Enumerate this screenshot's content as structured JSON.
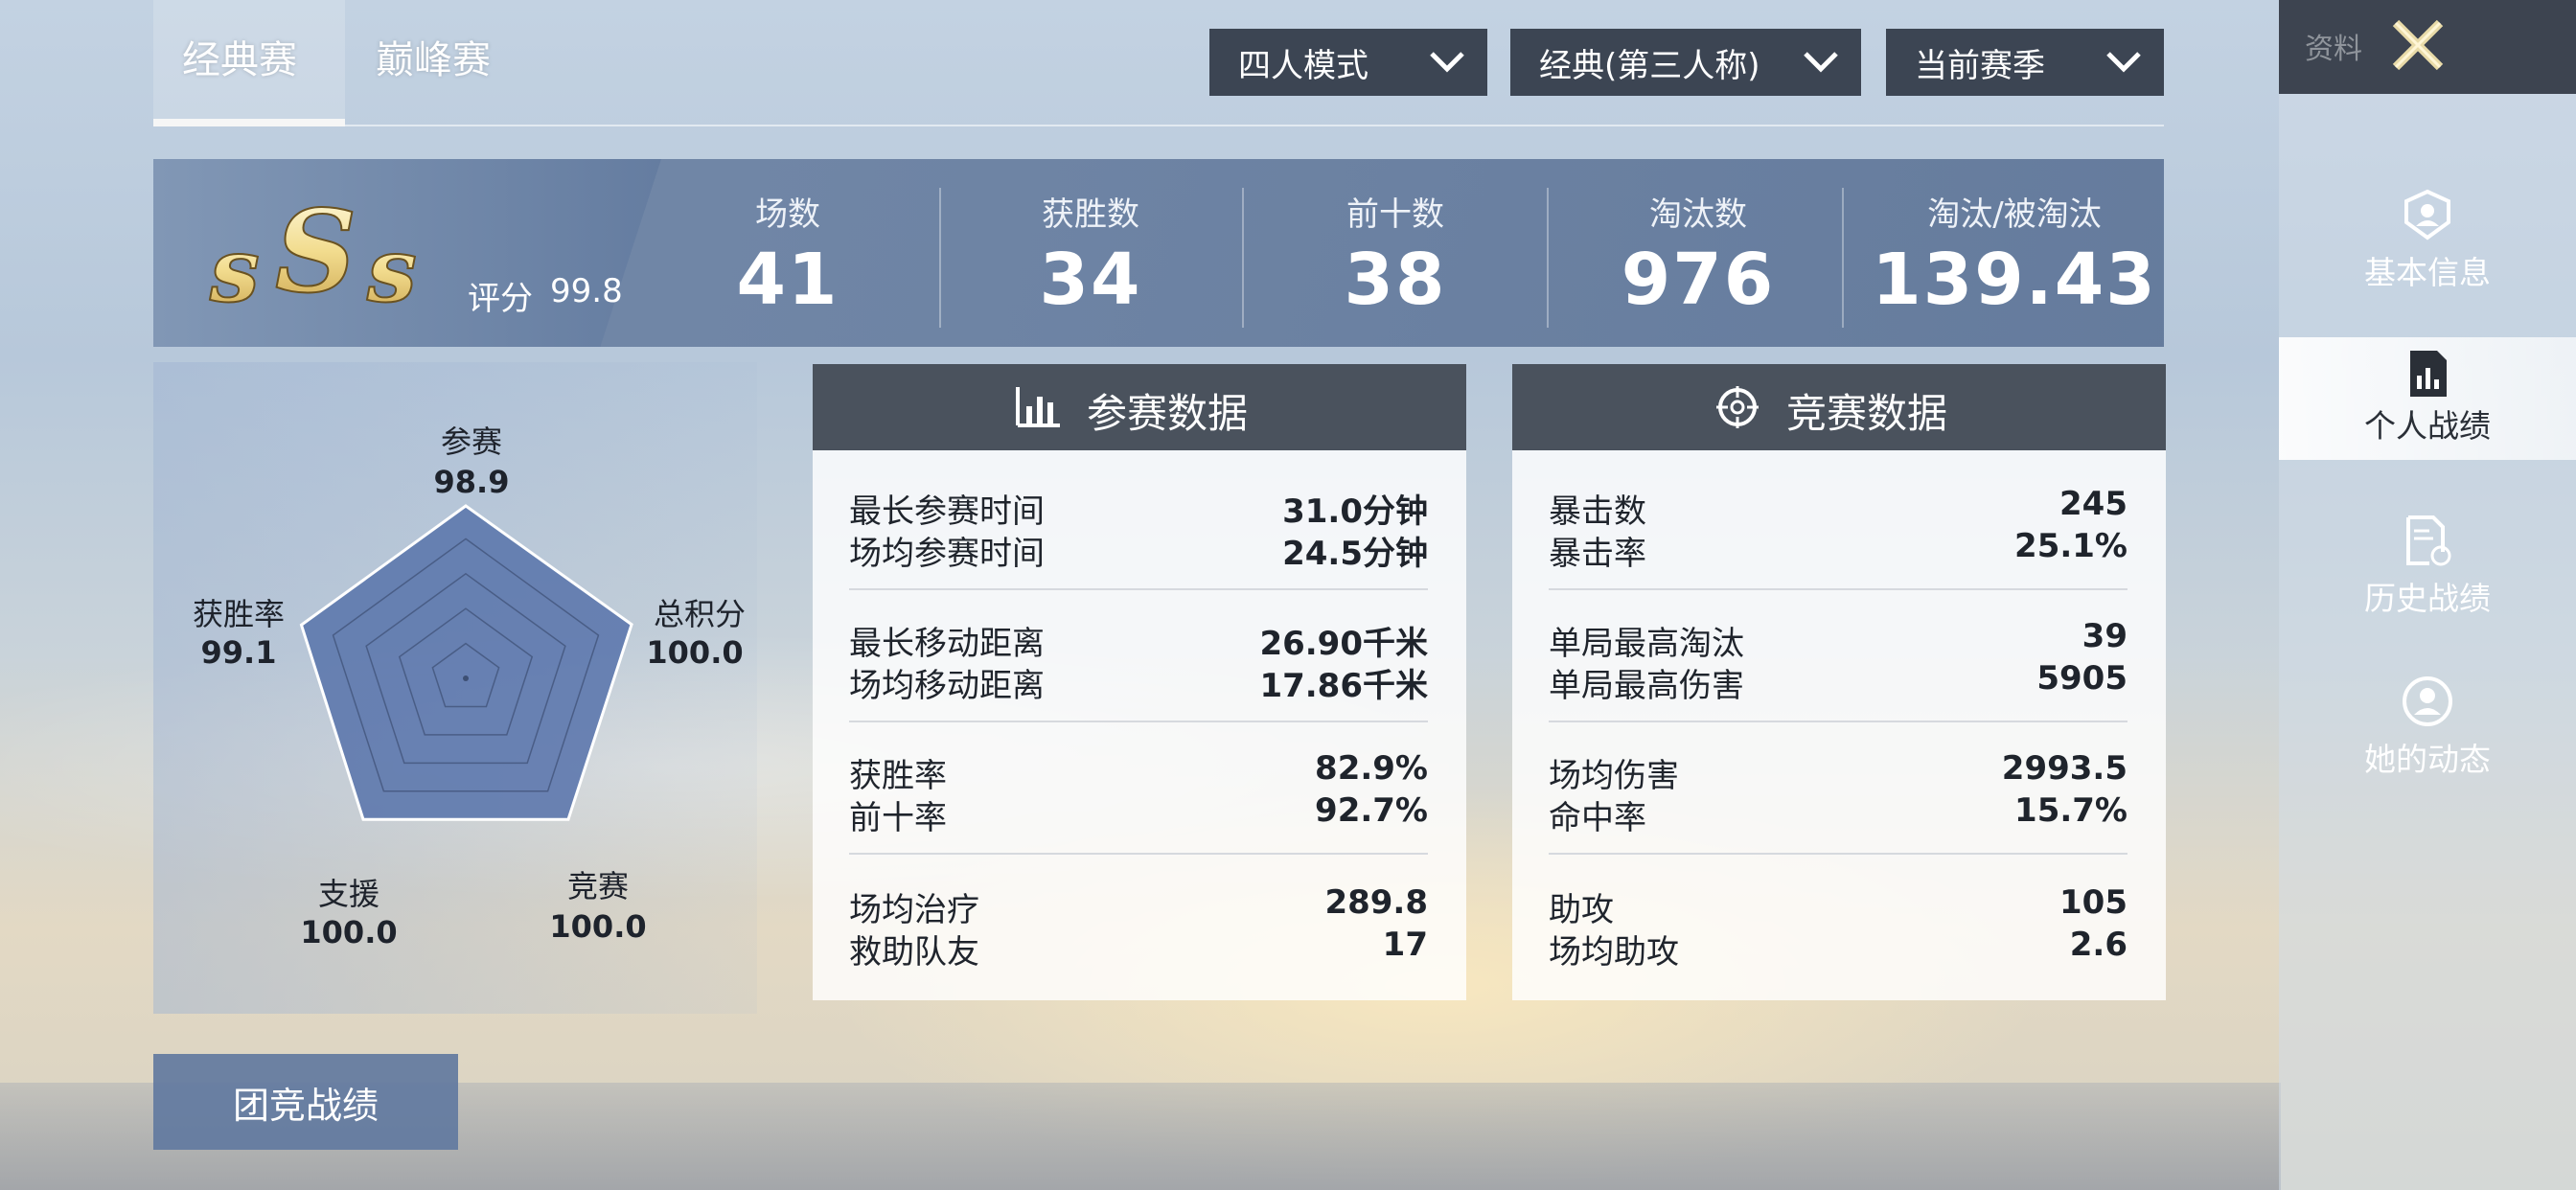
{
  "tabs": [
    {
      "label": "经典赛"
    },
    {
      "label": "巅峰赛"
    }
  ],
  "filters": {
    "mode": "四人模式",
    "perspective": "经典(第三人称)",
    "season": "当前赛季"
  },
  "side_panel": {
    "title": "资料",
    "nav": [
      {
        "label": "基本信息",
        "icon": "user-badge-icon"
      },
      {
        "label": "个人战绩",
        "icon": "bar-chart-doc-icon"
      },
      {
        "label": "历史战绩",
        "icon": "history-doc-icon"
      },
      {
        "label": "她的动态",
        "icon": "person-circle-icon"
      }
    ],
    "active": "个人战绩"
  },
  "score": {
    "rank": "SSS",
    "label": "评分",
    "value": "99.8"
  },
  "stats": [
    {
      "label": "场数",
      "value": "41"
    },
    {
      "label": "获胜数",
      "value": "34"
    },
    {
      "label": "前十数",
      "value": "38"
    },
    {
      "label": "淘汰数",
      "value": "976"
    },
    {
      "label": "淘汰/被淘汰",
      "value": "139.43"
    }
  ],
  "radar": {
    "axes": [
      {
        "label": "参赛",
        "value": 98.9,
        "text": "98.9"
      },
      {
        "label": "总积分",
        "value": 100.0,
        "text": "100.0"
      },
      {
        "label": "竞赛",
        "value": 100.0,
        "text": "100.0"
      },
      {
        "label": "支援",
        "value": 100.0,
        "text": "100.0"
      },
      {
        "label": "获胜率",
        "value": 99.1,
        "text": "99.1"
      }
    ],
    "max": 100,
    "fill_color": "#5d78ad"
  },
  "participation": {
    "title": "参赛数据",
    "groups": [
      [
        {
          "k": "最长参赛时间",
          "v": "31.0分钟"
        },
        {
          "k": "场均参赛时间",
          "v": "24.5分钟"
        }
      ],
      [
        {
          "k": "最长移动距离",
          "v": "26.90千米"
        },
        {
          "k": "场均移动距离",
          "v": "17.86千米"
        }
      ],
      [
        {
          "k": "获胜率",
          "v": "82.9%"
        },
        {
          "k": "前十率",
          "v": "92.7%"
        }
      ],
      [
        {
          "k": "场均治疗",
          "v": "289.8"
        },
        {
          "k": "救助队友",
          "v": "17"
        }
      ]
    ]
  },
  "competition": {
    "title": "竞赛数据",
    "groups": [
      [
        {
          "k": "暴击数",
          "v": "245"
        },
        {
          "k": "暴击率",
          "v": "25.1%"
        }
      ],
      [
        {
          "k": "单局最高淘汰",
          "v": "39"
        },
        {
          "k": "单局最高伤害",
          "v": "5905"
        }
      ],
      [
        {
          "k": "场均伤害",
          "v": "2993.5"
        },
        {
          "k": "命中率",
          "v": "15.7%"
        }
      ],
      [
        {
          "k": "助攻",
          "v": "105"
        },
        {
          "k": "场均助攻",
          "v": "2.6"
        }
      ]
    ]
  },
  "team_button": "团竞战绩"
}
